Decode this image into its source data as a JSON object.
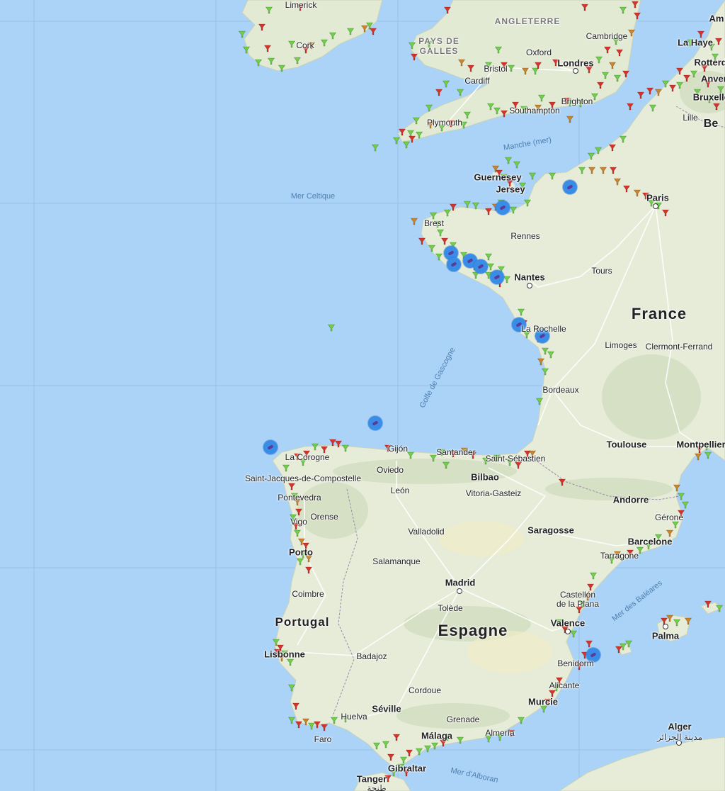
{
  "colors": {
    "sea": "#aad3f7",
    "land": "#e6ecd8",
    "marker_green": "#6fd04a",
    "marker_red": "#d8332b",
    "marker_orange": "#c9852f",
    "boat": "#3a8de6"
  },
  "labels": {
    "countries": {
      "france": "France",
      "espagne": "Espagne",
      "portugal": "Portugal"
    },
    "regions": {
      "angleterre": "ANGLETERRE",
      "galles_1": "PAYS DE",
      "galles_2": "GALLES"
    },
    "seas": {
      "celtique": "Mer Celtique",
      "manche": "Manche (mer)",
      "gascogne": "Golfe de Gascogne",
      "baleares": "Mer des Baléares",
      "alboran": "Mer d'Alboran"
    },
    "cities": {
      "limerick": "Limerick",
      "cork": "Cork",
      "cambridge": "Cambridge",
      "oxford": "Oxford",
      "londres": "Londres",
      "bristol": "Bristol",
      "cardiff": "Cardiff",
      "southampton": "Southampton",
      "brighton": "Brighton",
      "plymouth": "Plymouth",
      "la_haye": "La Haye",
      "rotterdam": "Rotterdam",
      "anvers": "Anvers",
      "bruxelles": "Bruxelles",
      "lille": "Lille",
      "be": "Be",
      "am": "Am",
      "guernesey": "Guernesey",
      "jersey": "Jersey",
      "paris": "Paris",
      "brest": "Brest",
      "rennes": "Rennes",
      "nantes": "Nantes",
      "tours": "Tours",
      "la_rochelle": "La Rochelle",
      "limoges": "Limoges",
      "clermont": "Clermont-Ferrand",
      "bordeaux": "Bordeaux",
      "toulouse": "Toulouse",
      "montpellier": "Montpellier",
      "la_corogne": "La Corogne",
      "gijon": "Gijón",
      "santander": "Santander",
      "saint_sebastien": "Saint-Sébastien",
      "oviedo": "Oviedo",
      "bilbao": "Bilbao",
      "compostelle": "Saint-Jacques-de-Compostelle",
      "leon": "León",
      "vitoria": "Vitoria-Gasteiz",
      "andorre": "Andorre",
      "pontevedra": "Pontevedra",
      "vigo": "Vigo",
      "orense": "Orense",
      "gerone": "Gérone",
      "valladolid": "Valladolid",
      "saragosse": "Saragosse",
      "barcelone": "Barcelone",
      "porto": "Porto",
      "salamanque": "Salamanque",
      "tarragone": "Tarragone",
      "madrid": "Madrid",
      "coimbre": "Coimbre",
      "castellon_1": "Castellón",
      "castellon_2": "de la Plana",
      "tolede": "Tolède",
      "valence": "Valence",
      "palma": "Palma",
      "lisbonne": "Lisbonne",
      "badajoz": "Badajoz",
      "benidorm": "Benidorm",
      "alicante": "Alicante",
      "cordoue": "Cordoue",
      "murcie": "Murcie",
      "seville": "Séville",
      "huelva": "Huelva",
      "grenade": "Grenade",
      "alger": "Alger",
      "alger_ar": "مدينة الجزائر",
      "faro": "Faro",
      "malaga": "Málaga",
      "almeria": "Almería",
      "gibraltar": "Gibraltar",
      "tanger": "Tanger",
      "tanger_ar": "طنجة"
    }
  }
}
